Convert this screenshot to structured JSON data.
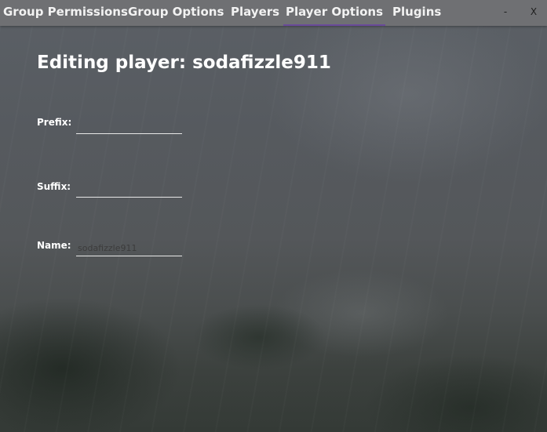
{
  "tabs": [
    {
      "label": "Group Permissions",
      "active": false
    },
    {
      "label": "Group Options",
      "active": false
    },
    {
      "label": "Players",
      "active": false
    },
    {
      "label": "Player Options",
      "active": true
    },
    {
      "label": "Plugins",
      "active": false
    }
  ],
  "window_controls": {
    "minimize_label": "-",
    "close_label": "X"
  },
  "heading": {
    "prefix": "Editing player:",
    "player_name": "sodafizzle911"
  },
  "fields": {
    "prefix": {
      "label": "Prefix:",
      "value": "",
      "placeholder": ""
    },
    "suffix": {
      "label": "Suffix:",
      "value": "",
      "placeholder": ""
    },
    "name": {
      "label": "Name:",
      "value": "",
      "placeholder": "sodafizzle911"
    }
  },
  "colors": {
    "tab_bar": "#6f7073",
    "active_tab_underline": "#6a4a9a",
    "text": "#ffffff"
  }
}
